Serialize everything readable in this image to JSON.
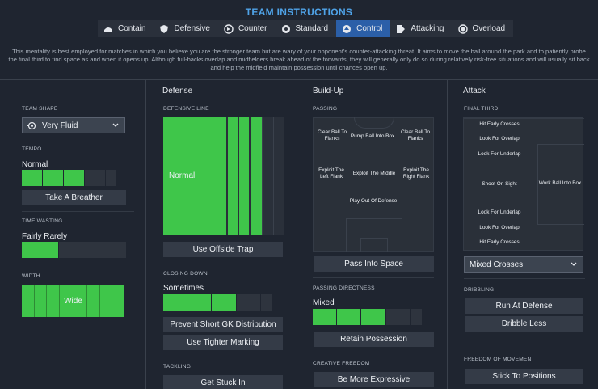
{
  "title": "TEAM INSTRUCTIONS",
  "mentality": [
    {
      "label": "Contain",
      "icon": "contain-icon"
    },
    {
      "label": "Defensive",
      "icon": "shield-icon"
    },
    {
      "label": "Counter",
      "icon": "counter-icon"
    },
    {
      "label": "Standard",
      "icon": "standard-icon"
    },
    {
      "label": "Control",
      "icon": "control-icon",
      "active": true
    },
    {
      "label": "Attacking",
      "icon": "attacking-icon"
    },
    {
      "label": "Overload",
      "icon": "overload-icon"
    }
  ],
  "description": "This mentality is best employed for matches in which you believe you are the stronger team but are wary of your opponent's counter-attacking threat. It aims to move the ball around the park and to patiently probe the final third to find space as and when it opens up. Although full-backs overlap and midfielders break ahead of the forwards, they will generally only do so during relatively risk-free situations and will usually sit back and help the midfield maintain possession until chances open up.",
  "columns": {
    "defense": "Defense",
    "buildup": "Build-Up",
    "attack": "Attack"
  },
  "team": {
    "shape_label": "TEAM SHAPE",
    "shape_value": "Very Fluid",
    "tempo_label": "TEMPO",
    "tempo_value": "Normal",
    "tempo_level": 0.6,
    "tempo_button": "Take A Breather",
    "time_wasting_label": "TIME WASTING",
    "time_wasting_value": "Fairly Rarely",
    "time_wasting_level": 0.35,
    "width_label": "WIDTH",
    "width_value": "Wide"
  },
  "defense": {
    "line_label": "DEFENSIVE LINE",
    "line_value": "Normal",
    "offside_button": "Use Offside Trap",
    "closing_label": "CLOSING DOWN",
    "closing_value": "Sometimes",
    "closing_level": 0.6,
    "prevent_gk_button": "Prevent Short GK Distribution",
    "tighter_marking_button": "Use Tighter Marking",
    "tackling_label": "TACKLING",
    "tackling_button": "Get Stuck In"
  },
  "buildup": {
    "passing_label": "PASSING",
    "passing_options": {
      "clear_left": "Clear Ball To Flanks",
      "pump": "Pump Ball Into Box",
      "clear_right": "Clear Ball To Flanks",
      "exploit_left": "Exploit The Left Flank",
      "exploit_middle": "Exploit The Middle",
      "exploit_right": "Exploit The Right Flank",
      "play_out": "Play Out Of Defense"
    },
    "pass_space_button": "Pass Into Space",
    "directness_label": "PASSING DIRECTNESS",
    "directness_value": "Mixed",
    "directness_level": 0.45,
    "retain_button": "Retain Possession",
    "creative_label": "CREATIVE FREEDOM",
    "creative_button": "Be More Expressive"
  },
  "attack": {
    "final_third_label": "FINAL THIRD",
    "final_third_options": {
      "early_crosses_top": "Hit Early Crosses",
      "overlap_top": "Look For Overlap",
      "underlap_top": "Look For Underlap",
      "shoot_on_sight": "Shoot On Sight",
      "work_into_box": "Work Ball Into Box",
      "underlap_bottom": "Look For Underlap",
      "overlap_bottom": "Look For Overlap",
      "early_crosses_bottom": "Hit Early Crosses"
    },
    "crossing_value": "Mixed Crosses",
    "dribbling_label": "DRIBBLING",
    "run_at_defense_button": "Run At Defense",
    "dribble_less_button": "Dribble Less",
    "freedom_label": "FREEDOM OF MOVEMENT",
    "stick_positions_button": "Stick To Positions"
  },
  "colors": {
    "accent": "#4fa3e8",
    "active_tab": "#2b5fa8",
    "slider_on": "#3fc64a"
  }
}
